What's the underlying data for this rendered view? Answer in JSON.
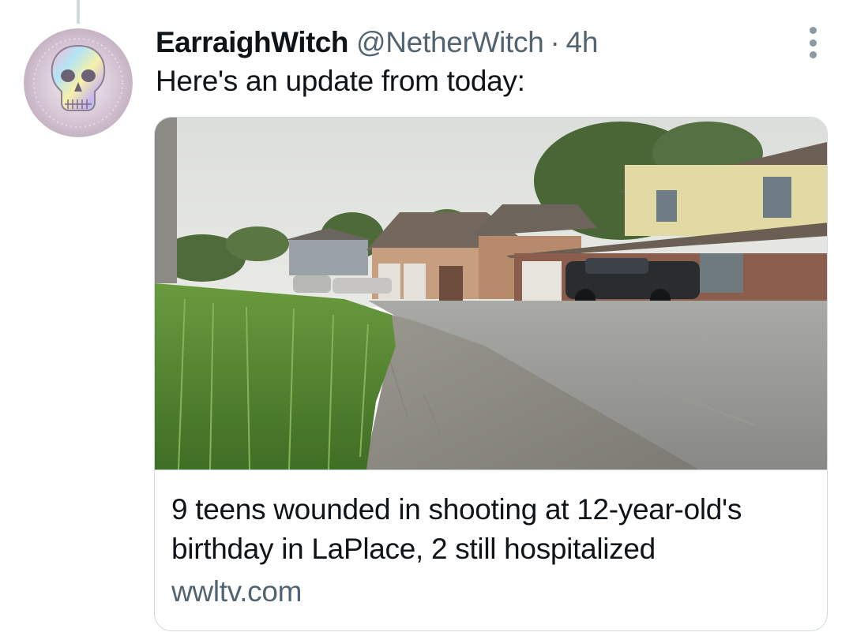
{
  "tweet": {
    "author": {
      "display_name": "EarraighWitch",
      "handle": "@NetherWitch",
      "avatar_icon": "skull-avatar-icon"
    },
    "separator": "·",
    "timestamp": "4h",
    "text": "Here's an update from today:",
    "more_icon": "more-vertical-icon"
  },
  "link_card": {
    "title": "9 teens wounded in shooting at 12-year-old's birthday in LaPlace, 2 still hospitalized",
    "domain": "wwltv.com",
    "image_icon": "article-photo"
  },
  "colors": {
    "text_primary": "#0f1419",
    "text_secondary": "#536471",
    "border": "#cfd9de",
    "thread_line": "#cfd9de"
  }
}
